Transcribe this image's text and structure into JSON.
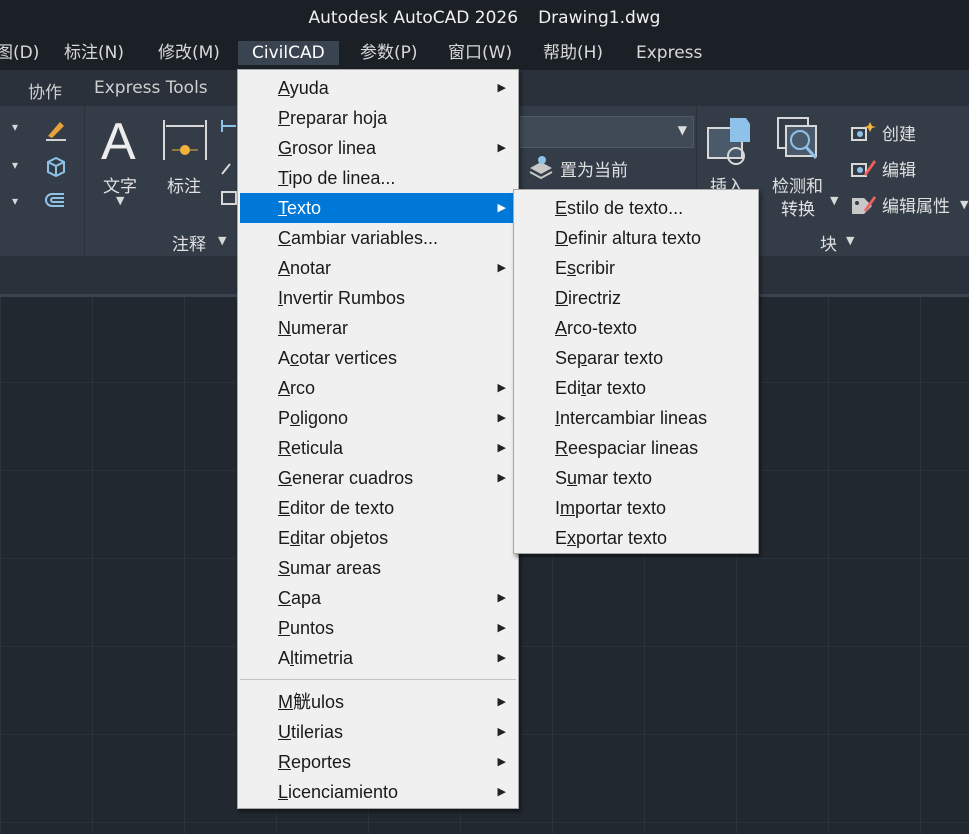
{
  "title": {
    "app": "Autodesk AutoCAD 2026",
    "file": "Drawing1.dwg"
  },
  "menubar": [
    {
      "label": "图(D)"
    },
    {
      "label": "标注(N)"
    },
    {
      "label": "修改(M)"
    },
    {
      "label": "CivilCAD"
    },
    {
      "label": "参数(P)"
    },
    {
      "label": "窗口(W)"
    },
    {
      "label": "帮助(H)"
    },
    {
      "label": "Express"
    }
  ],
  "ribbon_tabs": [
    {
      "label": "协作"
    },
    {
      "label": "Express Tools"
    }
  ],
  "ribbon": {
    "text_label": "文字",
    "dim_label": "标注",
    "annotation_panel": "注释",
    "set_current": "置为当前",
    "insert": "插入",
    "detect_convert_1": "检测和",
    "detect_convert_2": "转换",
    "create": "创建",
    "edit": "编辑",
    "edit_attrs": "编辑属性",
    "block_panel": "块"
  },
  "civilcad_menu": [
    {
      "label": "Ayuda",
      "u": "A",
      "pre": "",
      "post": "yuda",
      "sub": true
    },
    {
      "label": "Preparar hoja",
      "pre": "",
      "u": "P",
      "post": "reparar hoja",
      "sub": false
    },
    {
      "label": "Grosor linea",
      "pre": "",
      "u": "G",
      "post": "rosor linea",
      "sub": true
    },
    {
      "label": "Tipo de linea...",
      "pre": "",
      "u": "T",
      "post": "ipo de linea...",
      "sub": false
    },
    {
      "label": "Texto",
      "pre": "",
      "u": "T",
      "post": "exto",
      "sub": true,
      "hl": true
    },
    {
      "label": "Cambiar variables...",
      "pre": "",
      "u": "C",
      "post": "ambiar variables...",
      "sub": false
    },
    {
      "label": "Anotar",
      "pre": "",
      "u": "A",
      "post": "notar",
      "sub": true
    },
    {
      "label": "Invertir Rumbos",
      "pre": "",
      "u": "I",
      "post": "nvertir Rumbos",
      "sub": false
    },
    {
      "label": "Numerar",
      "pre": "",
      "u": "N",
      "post": "umerar",
      "sub": false
    },
    {
      "label": "Acotar vertices",
      "pre": "A",
      "u": "c",
      "post": "otar vertices",
      "sub": false
    },
    {
      "label": "Arco",
      "pre": "",
      "u": "A",
      "post": "rco",
      "sub": true
    },
    {
      "label": "Poligono",
      "pre": "P",
      "u": "o",
      "post": "ligono",
      "sub": true
    },
    {
      "label": "Reticula",
      "pre": "",
      "u": "R",
      "post": "eticula",
      "sub": true
    },
    {
      "label": "Generar cuadros",
      "pre": "",
      "u": "G",
      "post": "enerar cuadros",
      "sub": true
    },
    {
      "label": "Editor de texto",
      "pre": "",
      "u": "E",
      "post": "ditor de texto",
      "sub": false
    },
    {
      "label": "Editar objetos",
      "pre": "E",
      "u": "d",
      "post": "itar objetos",
      "sub": false
    },
    {
      "label": "Sumar areas",
      "pre": "",
      "u": "S",
      "post": "umar areas",
      "sub": false
    },
    {
      "label": "Capa",
      "pre": "",
      "u": "C",
      "post": "apa",
      "sub": true
    },
    {
      "label": "Puntos",
      "pre": "",
      "u": "P",
      "post": "untos",
      "sub": true
    },
    {
      "label": "Altimetria",
      "pre": "A",
      "u": "l",
      "post": "timetria",
      "sub": true
    },
    {
      "label": "M觥ulos",
      "pre": "",
      "u": "M",
      "post": "觥ulos",
      "sub": true
    },
    {
      "label": "Utilerias",
      "pre": "",
      "u": "U",
      "post": "tilerias",
      "sub": true
    },
    {
      "label": "Reportes",
      "pre": "",
      "u": "R",
      "post": "eportes",
      "sub": true
    },
    {
      "label": "Licenciamiento",
      "pre": "",
      "u": "L",
      "post": "icenciamiento",
      "sub": true
    }
  ],
  "texto_submenu": [
    {
      "label": "Estilo de texto...",
      "pre": "",
      "u": "E",
      "post": "stilo de texto..."
    },
    {
      "label": "Definir altura texto",
      "pre": "",
      "u": "D",
      "post": "efinir altura texto"
    },
    {
      "label": "Escribir",
      "pre": "E",
      "u": "s",
      "post": "cribir"
    },
    {
      "label": "Directriz",
      "pre": "",
      "u": "D",
      "post": "irectriz"
    },
    {
      "label": "Arco-texto",
      "pre": "",
      "u": "A",
      "post": "rco-texto"
    },
    {
      "label": "Separar texto",
      "pre": "Se",
      "u": "p",
      "post": "arar texto"
    },
    {
      "label": "Editar texto",
      "pre": "Edi",
      "u": "t",
      "post": "ar texto"
    },
    {
      "label": "Intercambiar lineas",
      "pre": "",
      "u": "I",
      "post": "ntercambiar lineas"
    },
    {
      "label": "Reespaciar lineas",
      "pre": "",
      "u": "R",
      "post": "eespaciar lineas"
    },
    {
      "label": "Sumar texto",
      "pre": "S",
      "u": "u",
      "post": "mar texto"
    },
    {
      "label": "Importar texto",
      "pre": "I",
      "u": "m",
      "post": "portar texto"
    },
    {
      "label": "Exportar texto",
      "pre": "E",
      "u": "x",
      "post": "portar texto"
    }
  ]
}
